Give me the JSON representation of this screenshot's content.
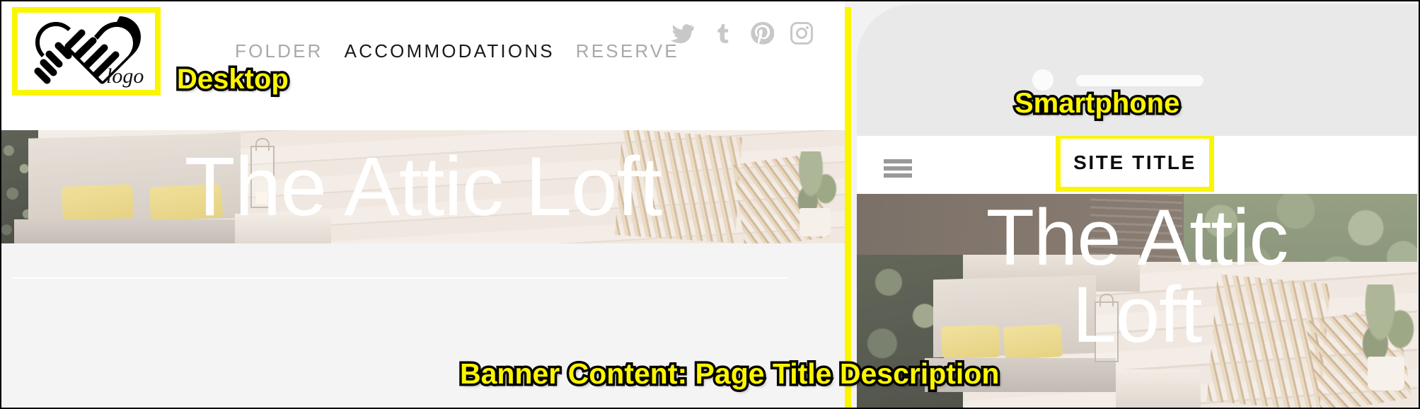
{
  "annotations": {
    "desktop_label": "Desktop",
    "smartphone_label": "Smartphone",
    "banner_label": "Banner Content: Page Title Description",
    "highlight_color": "#fbf500",
    "outline_color": "#000000"
  },
  "desktop": {
    "logo": {
      "icon": "handshake-heart-logo-icon",
      "wordmark": "logo",
      "highlighted": true
    },
    "nav": {
      "items": [
        {
          "label": "FOLDER",
          "active": false
        },
        {
          "label": "ACCOMMODATIONS",
          "active": true
        },
        {
          "label": "RESERVE",
          "active": false
        }
      ],
      "active_color": "#1a1a1a",
      "inactive_color": "#a9a9a9"
    },
    "socials": [
      {
        "name": "twitter-icon",
        "label": "Twitter"
      },
      {
        "name": "tumblr-icon",
        "label": "Tumblr"
      },
      {
        "name": "pinterest-icon",
        "label": "Pinterest"
      },
      {
        "name": "instagram-icon",
        "label": "Instagram"
      }
    ],
    "social_color": "#c8c8c8",
    "hero": {
      "title": "The Attic Loft",
      "title_color": "#ffffff",
      "image_alt": "patio-with-yellow-cushions-and-wooden-chairs"
    },
    "body": {
      "background": "#f4f4f4"
    }
  },
  "smartphone": {
    "bezel_color": "#e9e9e9",
    "camera": "front-camera",
    "speaker": "earpiece-speaker",
    "topbar": {
      "menu_icon": "hamburger-menu-icon",
      "site_title": "SITE TITLE",
      "site_title_highlighted": true
    },
    "hero": {
      "title_line_1": "The Attic",
      "title_line_2": "Loft",
      "title_color": "#ffffff",
      "image_alt": "patio-with-hedges-cushions-and-wooden-chairs"
    }
  }
}
